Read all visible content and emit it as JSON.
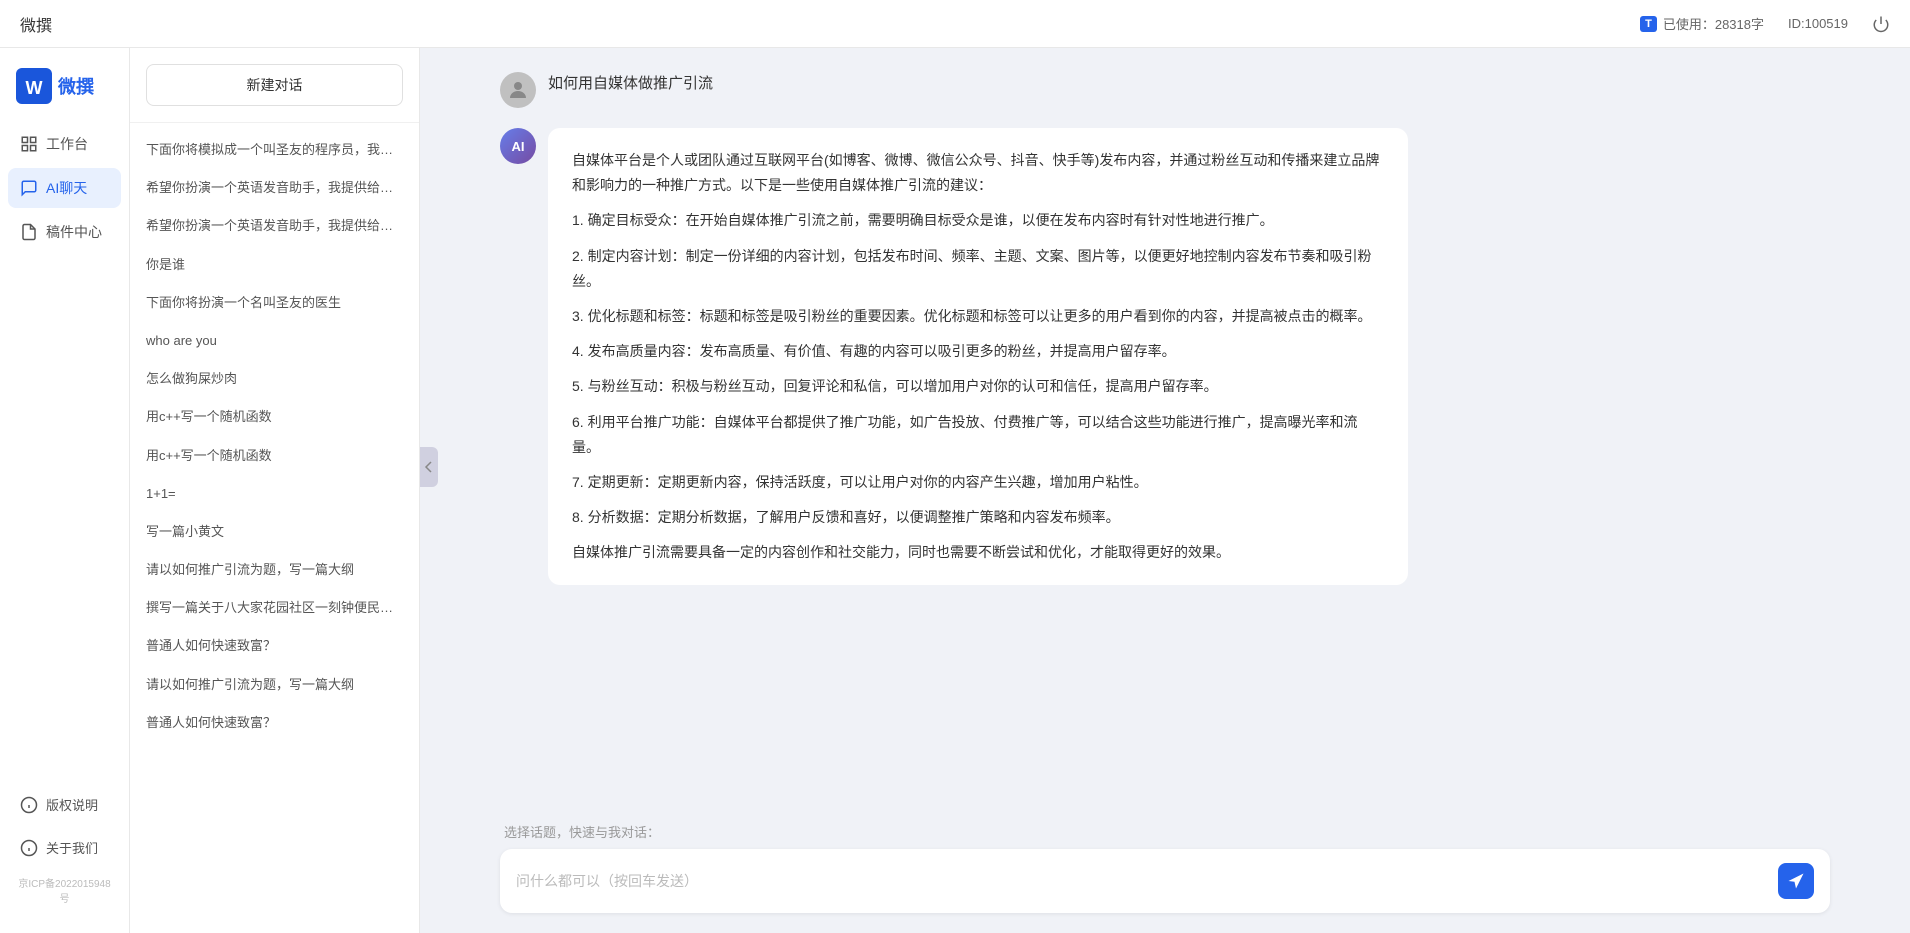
{
  "topbar": {
    "title": "微撰",
    "usage_label": "已使用：28318字",
    "id_label": "ID:100519",
    "usage_icon": "T"
  },
  "logo": {
    "text": "微撰",
    "icon_letter": "W"
  },
  "nav": {
    "items": [
      {
        "id": "workspace",
        "label": "工作台",
        "icon": "grid"
      },
      {
        "id": "ai-chat",
        "label": "AI聊天",
        "icon": "chat",
        "active": true
      },
      {
        "id": "drafts",
        "label": "稿件中心",
        "icon": "doc"
      }
    ],
    "bottom_items": [
      {
        "id": "copyright",
        "label": "版权说明",
        "icon": "info"
      },
      {
        "id": "about",
        "label": "关于我们",
        "icon": "circle-info"
      }
    ],
    "icp": "京ICP备2022015948号"
  },
  "history": {
    "new_chat_label": "新建对话",
    "items": [
      {
        "id": "h1",
        "text": "下面你将模拟成一个叫圣友的程序员，我说...",
        "active": false
      },
      {
        "id": "h2",
        "text": "希望你扮演一个英语发音助手，我提供给你...",
        "active": false
      },
      {
        "id": "h3",
        "text": "希望你扮演一个英语发音助手，我提供给你...",
        "active": false
      },
      {
        "id": "h4",
        "text": "你是谁",
        "active": false
      },
      {
        "id": "h5",
        "text": "下面你将扮演一个名叫圣友的医生",
        "active": false
      },
      {
        "id": "h6",
        "text": "who are you",
        "active": false
      },
      {
        "id": "h7",
        "text": "怎么做狗屎炒肉",
        "active": false
      },
      {
        "id": "h8",
        "text": "用c++写一个随机函数",
        "active": false
      },
      {
        "id": "h9",
        "text": "用c++写一个随机函数",
        "active": false
      },
      {
        "id": "h10",
        "text": "1+1=",
        "active": false
      },
      {
        "id": "h11",
        "text": "写一篇小黄文",
        "active": false
      },
      {
        "id": "h12",
        "text": "请以如何推广引流为题，写一篇大纲",
        "active": false
      },
      {
        "id": "h13",
        "text": "撰写一篇关于八大家花园社区一刻钟便民生...",
        "active": false
      },
      {
        "id": "h14",
        "text": "普通人如何快速致富？",
        "active": false
      },
      {
        "id": "h15",
        "text": "请以如何推广引流为题，写一篇大纲",
        "active": false
      },
      {
        "id": "h16",
        "text": "普通人如何快速致富？",
        "active": false
      }
    ]
  },
  "chat": {
    "user_msg": "如何用自媒体做推广引流",
    "ai_response": {
      "paragraphs": [
        "自媒体平台是个人或团队通过互联网平台(如博客、微博、微信公众号、抖音、快手等)发布内容，并通过粉丝互动和传播来建立品牌和影响力的一种推广方式。以下是一些使用自媒体推广引流的建议：",
        "1. 确定目标受众：在开始自媒体推广引流之前，需要明确目标受众是谁，以便在发布内容时有针对性地进行推广。",
        "2. 制定内容计划：制定一份详细的内容计划，包括发布时间、频率、主题、文案、图片等，以便更好地控制内容发布节奏和吸引粉丝。",
        "3. 优化标题和标签：标题和标签是吸引粉丝的重要因素。优化标题和标签可以让更多的用户看到你的内容，并提高被点击的概率。",
        "4. 发布高质量内容：发布高质量、有价值、有趣的内容可以吸引更多的粉丝，并提高用户留存率。",
        "5. 与粉丝互动：积极与粉丝互动，回复评论和私信，可以增加用户对你的认可和信任，提高用户留存率。",
        "6. 利用平台推广功能：自媒体平台都提供了推广功能，如广告投放、付费推广等，可以结合这些功能进行推广，提高曝光率和流量。",
        "7. 定期更新：定期更新内容，保持活跃度，可以让用户对你的内容产生兴趣，增加用户粘性。",
        "8. 分析数据：定期分析数据，了解用户反馈和喜好，以便调整推广策略和内容发布频率。",
        "自媒体推广引流需要具备一定的内容创作和社交能力，同时也需要不断尝试和优化，才能取得更好的效果。"
      ]
    }
  },
  "input": {
    "quick_topics_label": "选择话题，快速与我对话：",
    "placeholder": "问什么都可以（按回车发送）",
    "send_icon": "send"
  }
}
